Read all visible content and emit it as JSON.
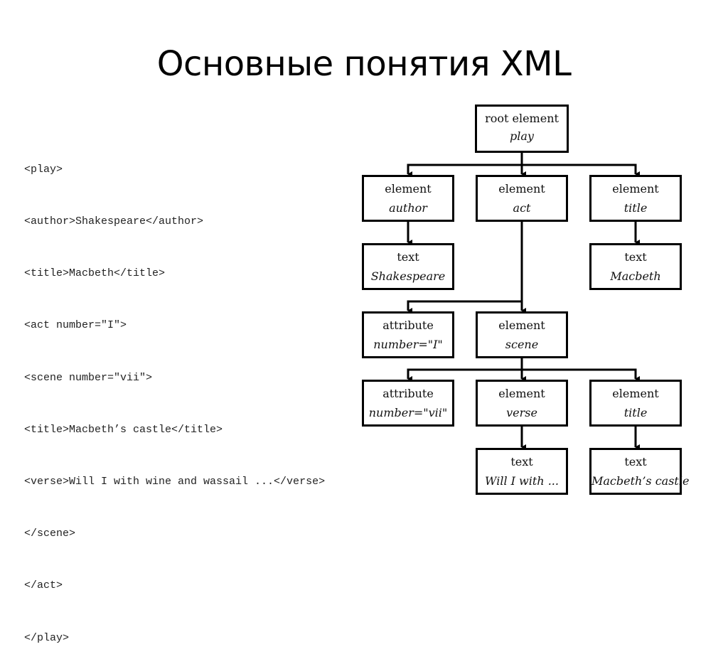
{
  "slide": {
    "title": "Основные понятия XML"
  },
  "xml_code": {
    "lines": [
      "<play>",
      "<author>Shakespeare</author>",
      "<title>Macbeth</title>",
      "<act number=\"I\">",
      "<scene number=\"vii\">",
      "<title>Macbeth’s castle</title>",
      "<verse>Will I with wine and wassail ...</verse>",
      "</scene>",
      "</act>",
      "</play>"
    ]
  },
  "tree": {
    "nodes": {
      "root": {
        "kind": "root element",
        "value": "play"
      },
      "author": {
        "kind": "element",
        "value": "author"
      },
      "act": {
        "kind": "element",
        "value": "act"
      },
      "title": {
        "kind": "element",
        "value": "title"
      },
      "text_shakespeare": {
        "kind": "text",
        "value": "Shakespeare"
      },
      "text_macbeth": {
        "kind": "text",
        "value": "Macbeth"
      },
      "attr_act": {
        "kind": "attribute",
        "value": "number=\"I\""
      },
      "scene": {
        "kind": "element",
        "value": "scene"
      },
      "attr_scene": {
        "kind": "attribute",
        "value": "number=\"vii\""
      },
      "verse": {
        "kind": "element",
        "value": "verse"
      },
      "scene_title": {
        "kind": "element",
        "value": "title"
      },
      "text_verse": {
        "kind": "text",
        "value": "Will I with ..."
      },
      "text_castle": {
        "kind": "text",
        "value": "Macbeth’s castle"
      }
    },
    "edges": [
      [
        "root",
        "author"
      ],
      [
        "root",
        "act"
      ],
      [
        "root",
        "title"
      ],
      [
        "author",
        "text_shakespeare"
      ],
      [
        "title",
        "text_macbeth"
      ],
      [
        "act",
        "attr_act"
      ],
      [
        "act",
        "scene"
      ],
      [
        "scene",
        "attr_scene"
      ],
      [
        "scene",
        "verse"
      ],
      [
        "scene",
        "scene_title"
      ],
      [
        "verse",
        "text_verse"
      ],
      [
        "scene_title",
        "text_castle"
      ]
    ]
  }
}
